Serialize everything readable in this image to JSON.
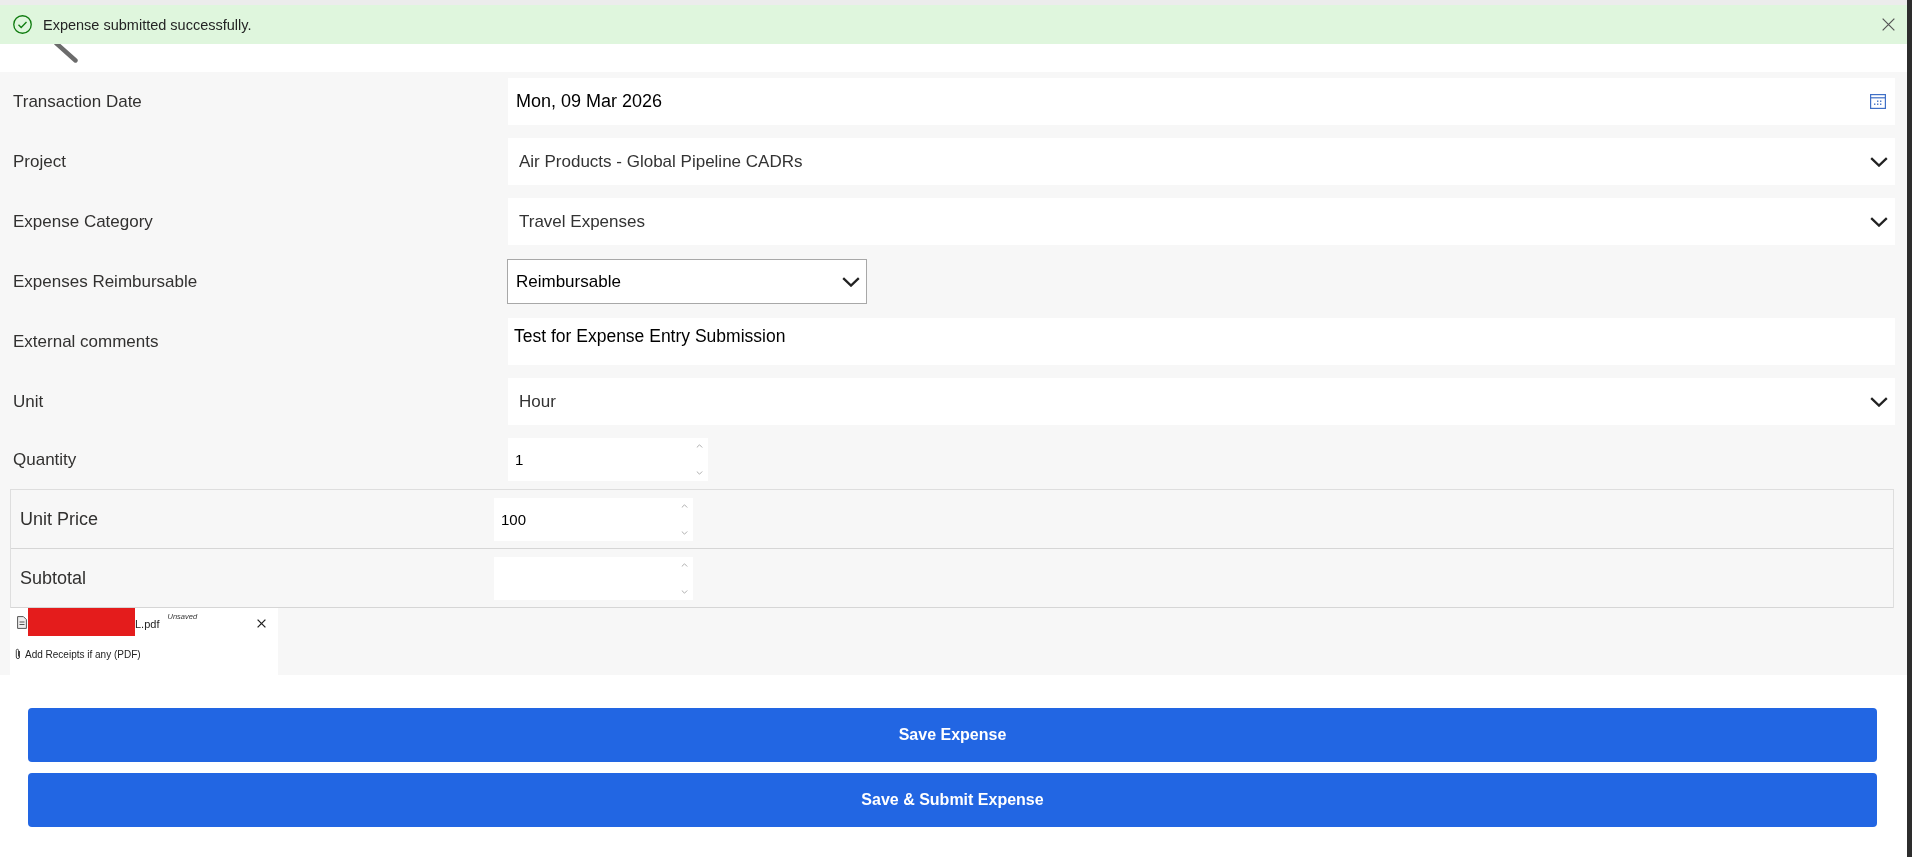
{
  "notification": {
    "kind": "success",
    "message": "Expense submitted successfully."
  },
  "fields": [
    {
      "label": "Transaction Date",
      "kind": "date",
      "value": "Mon, 09 Mar 2026"
    },
    {
      "label": "Project",
      "kind": "select",
      "value": "Air Products - Global Pipeline CADRs"
    },
    {
      "label": "Expense Category",
      "kind": "select",
      "value": "Travel Expenses"
    },
    {
      "label": "Expenses Reimbursable",
      "kind": "native-select",
      "value": "Reimbursable"
    },
    {
      "label": "External comments",
      "kind": "textarea",
      "value": "Test for Expense Entry Submission"
    },
    {
      "label": "Unit",
      "kind": "select",
      "value": "Hour"
    },
    {
      "label": "Quantity",
      "kind": "number",
      "value": "1"
    }
  ],
  "price_rows": [
    {
      "label": "Unit Price",
      "value": "100"
    },
    {
      "label": "Subtotal"
    }
  ],
  "attachments": {
    "files": [
      {
        "name": "L.pdf",
        "redacted": true,
        "status": "Unsaved"
      }
    ],
    "add_label": "Add Receipts if any (PDF)"
  },
  "buttons": [
    {
      "label": "Save Expense"
    },
    {
      "label": "Save & Submit Expense"
    }
  ]
}
